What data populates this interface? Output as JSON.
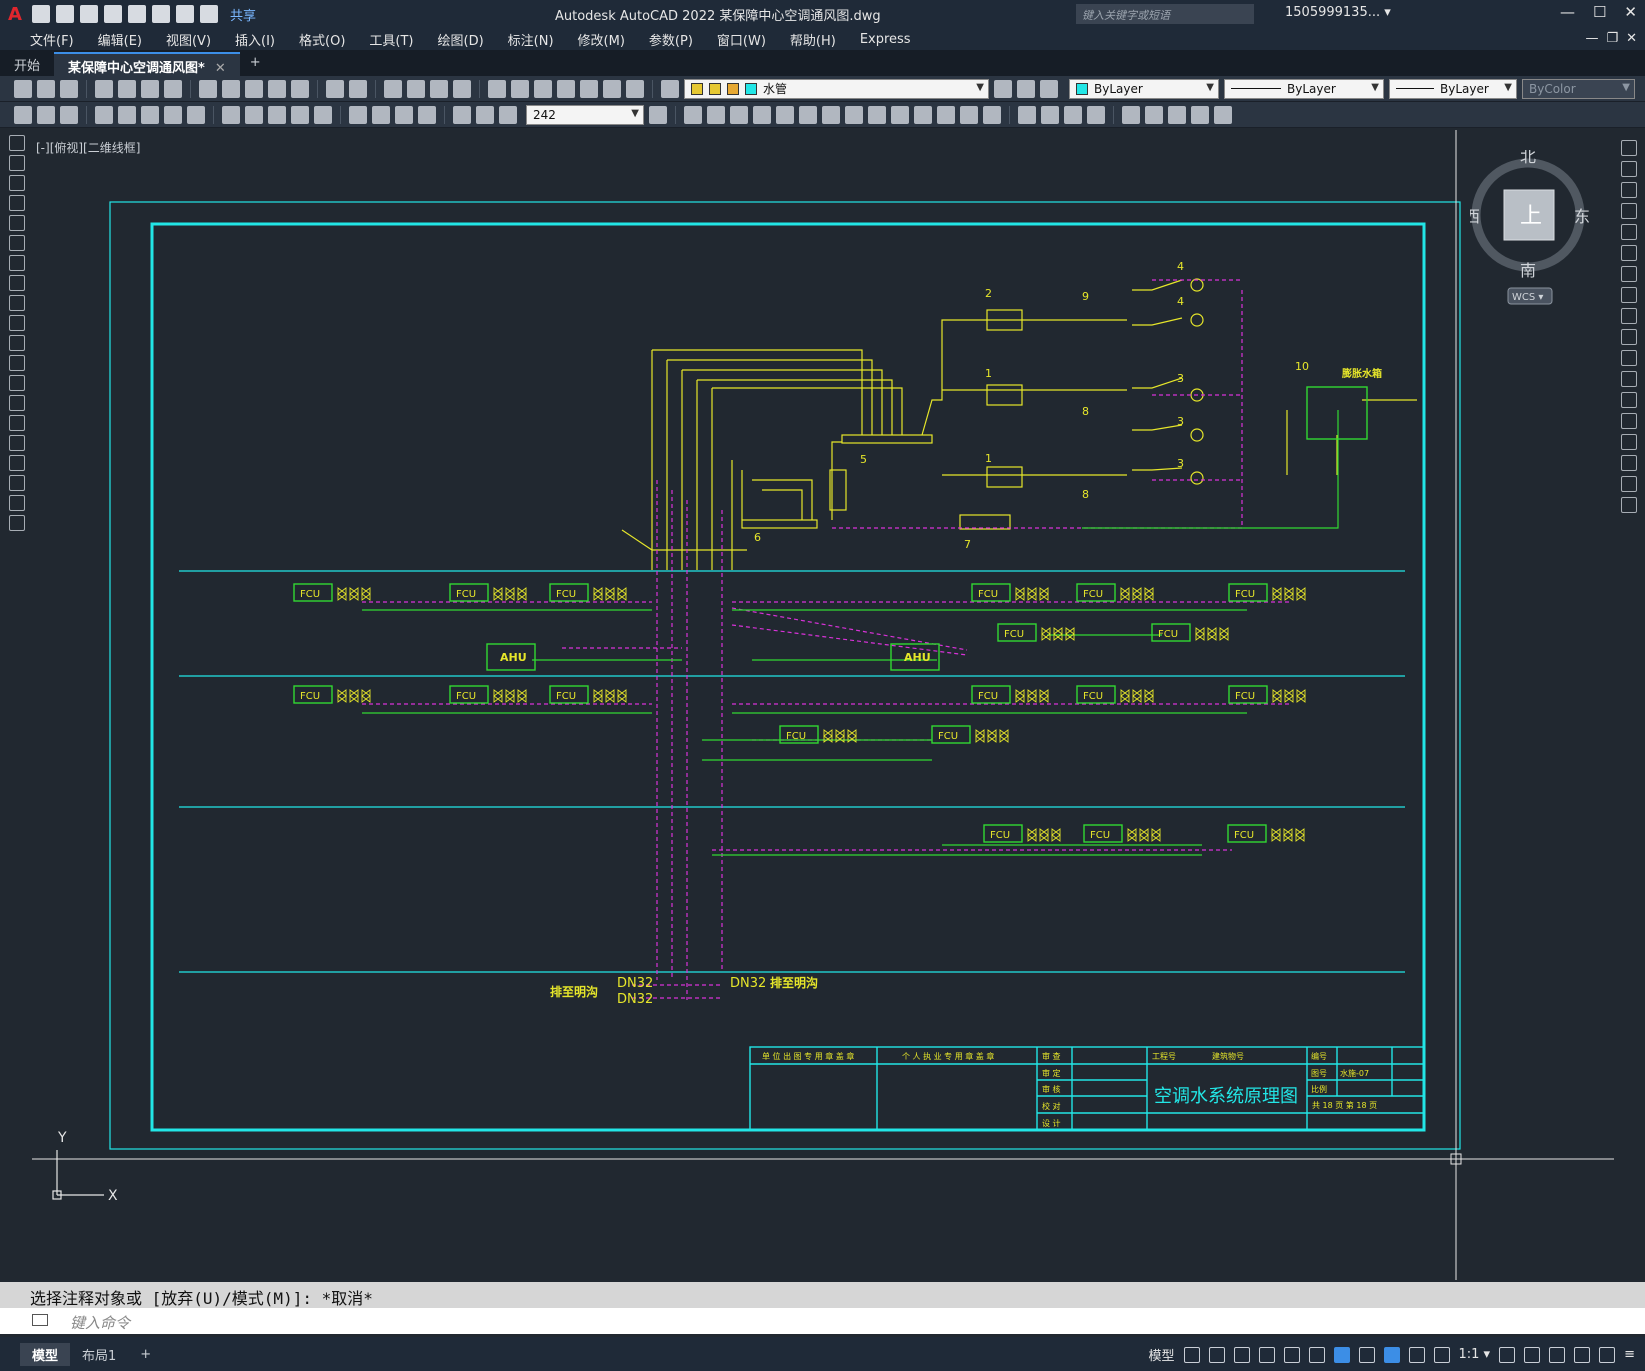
{
  "app": {
    "logo": "A",
    "title": "Autodesk AutoCAD 2022    某保障中心空调通风图.dwg",
    "share_label": "共享",
    "search_placeholder": "键入关键字或短语",
    "user": "1505999135... ▾"
  },
  "menu": [
    "文件(F)",
    "编辑(E)",
    "视图(V)",
    "插入(I)",
    "格式(O)",
    "工具(T)",
    "绘图(D)",
    "标注(N)",
    "修改(M)",
    "参数(P)",
    "窗口(W)",
    "帮助(H)",
    "Express"
  ],
  "tabs": [
    {
      "label": "开始"
    },
    {
      "label": "某保障中心空调通风图*"
    }
  ],
  "toolbar": {
    "layer_name": "水管",
    "color": "ByLayer",
    "linetype": "ByLayer",
    "lineweight": "ByLayer",
    "plotstyle": "ByColor",
    "dimstyle_value": "242"
  },
  "viewport": {
    "label": "[-][俯视][二维线框]",
    "viewcube": {
      "north": "北",
      "south": "南",
      "east": "东",
      "west": "西",
      "top": "上",
      "wcs": "WCS ▾"
    },
    "ucs": {
      "x": "X",
      "y": "Y"
    }
  },
  "drawing": {
    "colors": {
      "cyan": "#22e6e6",
      "yellow": "#e6e62a",
      "magenta": "#d832d8",
      "green": "#32d832",
      "white": "#e6e6e6"
    },
    "fcu_label": "FCU",
    "ahu_label": "AHU",
    "drain_labels": [
      "DN32",
      "DN32",
      "DN32"
    ],
    "drain_text": [
      "排至明沟",
      "排至明沟"
    ],
    "tank_label": "膨胀水箱",
    "numbers": [
      "1",
      "1",
      "2",
      "3",
      "3",
      "3",
      "4",
      "4",
      "5",
      "6",
      "7",
      "8",
      "8",
      "9",
      "10"
    ],
    "title_block": {
      "drawing_title": "空调水系统原理图",
      "col1": "单 位 出 图 专 用 章 盖 章",
      "col2": "个 人 执 业 专 用 章 盖 章",
      "rows": [
        "审 查",
        "审 定",
        "审 核",
        "校 对",
        "设 计"
      ],
      "project_no": "工程号",
      "building_no": "建筑物号",
      "number_label": "编号",
      "drawing_no_label": "图号",
      "drawing_no": "水施-07",
      "scale_label": "比例",
      "pages": "共  18  页  第  18  页"
    }
  },
  "command": {
    "history": "选择注释对象或 [放弃(U)/模式(M)]: *取消*",
    "placeholder": "键入命令"
  },
  "status": {
    "layout_tabs": [
      "模型",
      "布局1"
    ],
    "model_label": "模型",
    "scale": "1:1 ▾"
  }
}
